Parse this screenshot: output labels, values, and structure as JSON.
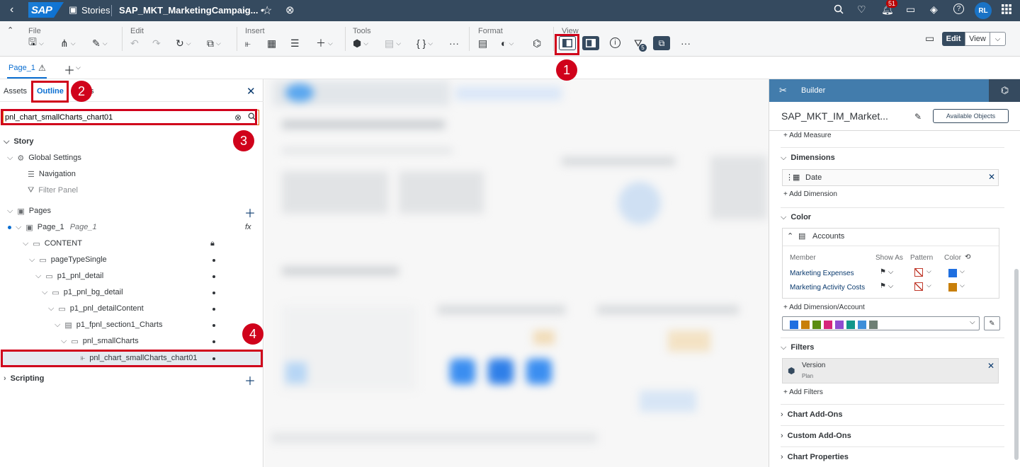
{
  "shell": {
    "stories_label": "Stories",
    "doc_title": "SAP_MKT_MarketingCampaig... •",
    "notifications_count": "51",
    "avatar_initials": "RL"
  },
  "toolbar": {
    "groups": [
      "File",
      "Edit",
      "Insert",
      "Tools",
      "Format",
      "View"
    ],
    "tools_braces": "{ }",
    "filter_count": "5",
    "edit_label": "Edit",
    "view_label": "View"
  },
  "pagebar": {
    "page_tab": "Page_1"
  },
  "outline": {
    "tab_assets": "Assets",
    "tab_outline": "Outline",
    "tab_partial": "s",
    "search_value": "pnl_chart_smallCharts_chart01",
    "tree": [
      {
        "label": "Story"
      },
      {
        "label": "Global Settings"
      },
      {
        "label": "Navigation"
      },
      {
        "label": "Filter Panel"
      },
      {
        "label": "Pages"
      },
      {
        "label": "Page_1",
        "alias": "Page_1"
      },
      {
        "label": "CONTENT"
      },
      {
        "label": "pageTypeSingle"
      },
      {
        "label": "p1_pnl_detail"
      },
      {
        "label": "p1_pnl_bg_detail"
      },
      {
        "label": "p1_pnl_detailContent"
      },
      {
        "label": "p1_fpnl_section1_Charts"
      },
      {
        "label": "pnl_smallCharts"
      },
      {
        "label": "pnl_chart_smallCharts_chart01"
      },
      {
        "label": "Scripting"
      }
    ]
  },
  "callouts": [
    "1",
    "2",
    "3",
    "4"
  ],
  "builder": {
    "title": "Builder",
    "model_name": "SAP_MKT_IM_Market...",
    "available_objects": "Available Objects",
    "add_measure": "Add Measure",
    "dimensions_label": "Dimensions",
    "dimension_value": "Date",
    "add_dimension": "Add Dimension",
    "color_label": "Color",
    "accounts_label": "Accounts",
    "col_member": "Member",
    "col_show_as": "Show As",
    "col_pattern": "Pattern",
    "col_color": "Color",
    "members": [
      {
        "name": "Marketing Expenses",
        "color": "#1f6fe0"
      },
      {
        "name": "Marketing Activity Costs",
        "color": "#c87f0a"
      }
    ],
    "add_dim_account": "Add Dimension/Account",
    "palette": [
      "#1f6fe0",
      "#c87f0a",
      "#5b8c12",
      "#d6257a",
      "#8e4ccf",
      "#11978a",
      "#3d8fd9",
      "#6e7f74"
    ],
    "filters_label": "Filters",
    "filter_name": "Version",
    "filter_value": "Plan",
    "add_filters": "Add Filters",
    "chart_addons": "Chart Add-Ons",
    "custom_addons": "Custom Add-Ons",
    "chart_properties": "Chart Properties"
  }
}
